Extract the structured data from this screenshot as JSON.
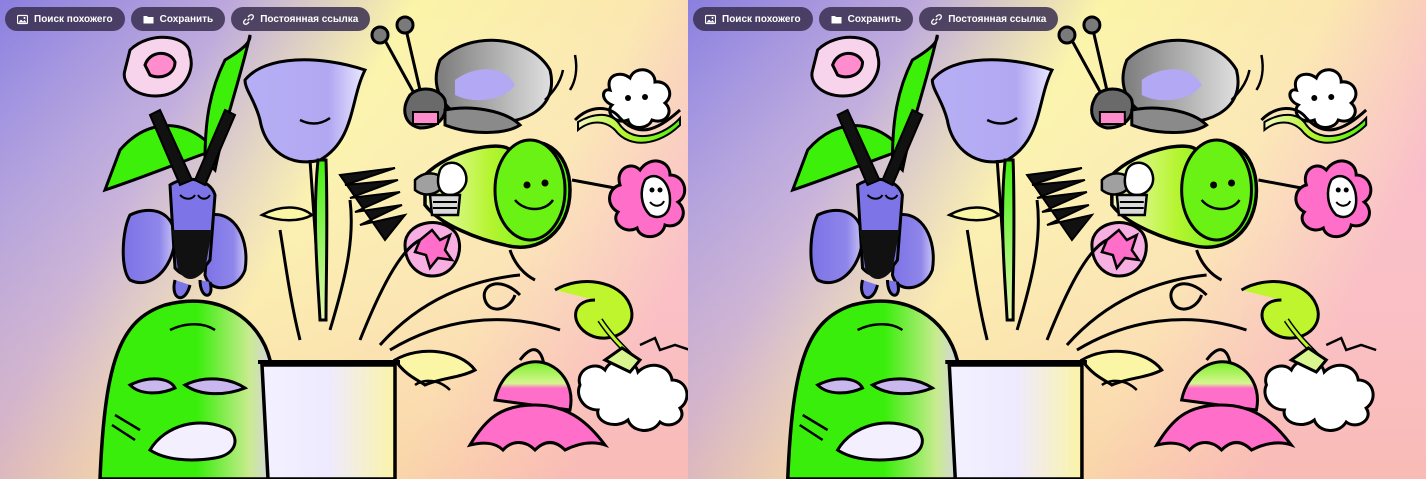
{
  "toolbar": {
    "similar_label": "Поиск похожего",
    "save_label": "Сохранить",
    "permalink_label": "Постоянная ссылка"
  },
  "icons": {
    "similar": "image-icon",
    "save": "folder-icon",
    "permalink": "link-icon"
  },
  "colors": {
    "pill_bg": "#3a3050",
    "pill_text": "#ffffff",
    "bg_purple": "#8f82e0",
    "bg_yellow": "#fbf5a6",
    "bg_pink": "#f9b8c4",
    "green": "#3df00a",
    "lime": "#b8f530",
    "lavender": "#b6aef5",
    "pink": "#ff6ec8",
    "blue_purple": "#7d74e8"
  }
}
